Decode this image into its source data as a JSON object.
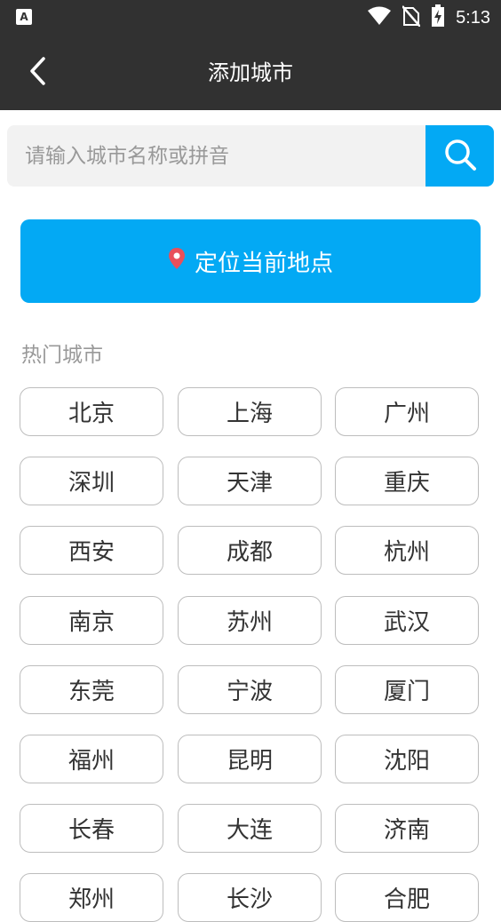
{
  "status_bar": {
    "left_icon": "A",
    "time": "5:13",
    "icons": [
      "wifi-icon",
      "no-sim-icon",
      "battery-charging-icon"
    ]
  },
  "header": {
    "title": "添加城市",
    "back_icon": "chevron-left-icon"
  },
  "search": {
    "placeholder": "请输入城市名称或拼音",
    "value": "",
    "button_icon": "search-icon"
  },
  "locate": {
    "label": "定位当前地点",
    "icon": "location-pin-icon"
  },
  "hot_cities": {
    "title": "热门城市",
    "items": [
      "北京",
      "上海",
      "广州",
      "深圳",
      "天津",
      "重庆",
      "西安",
      "成都",
      "杭州",
      "南京",
      "苏州",
      "武汉",
      "东莞",
      "宁波",
      "厦门",
      "福州",
      "昆明",
      "沈阳",
      "长春",
      "大连",
      "济南",
      "郑州",
      "长沙",
      "合肥"
    ]
  },
  "colors": {
    "status_bar_bg": "#313131",
    "accent": "#03a9f4",
    "pin": "#e8505b",
    "chip_border": "#bdbdbd",
    "muted_text": "#999999"
  }
}
